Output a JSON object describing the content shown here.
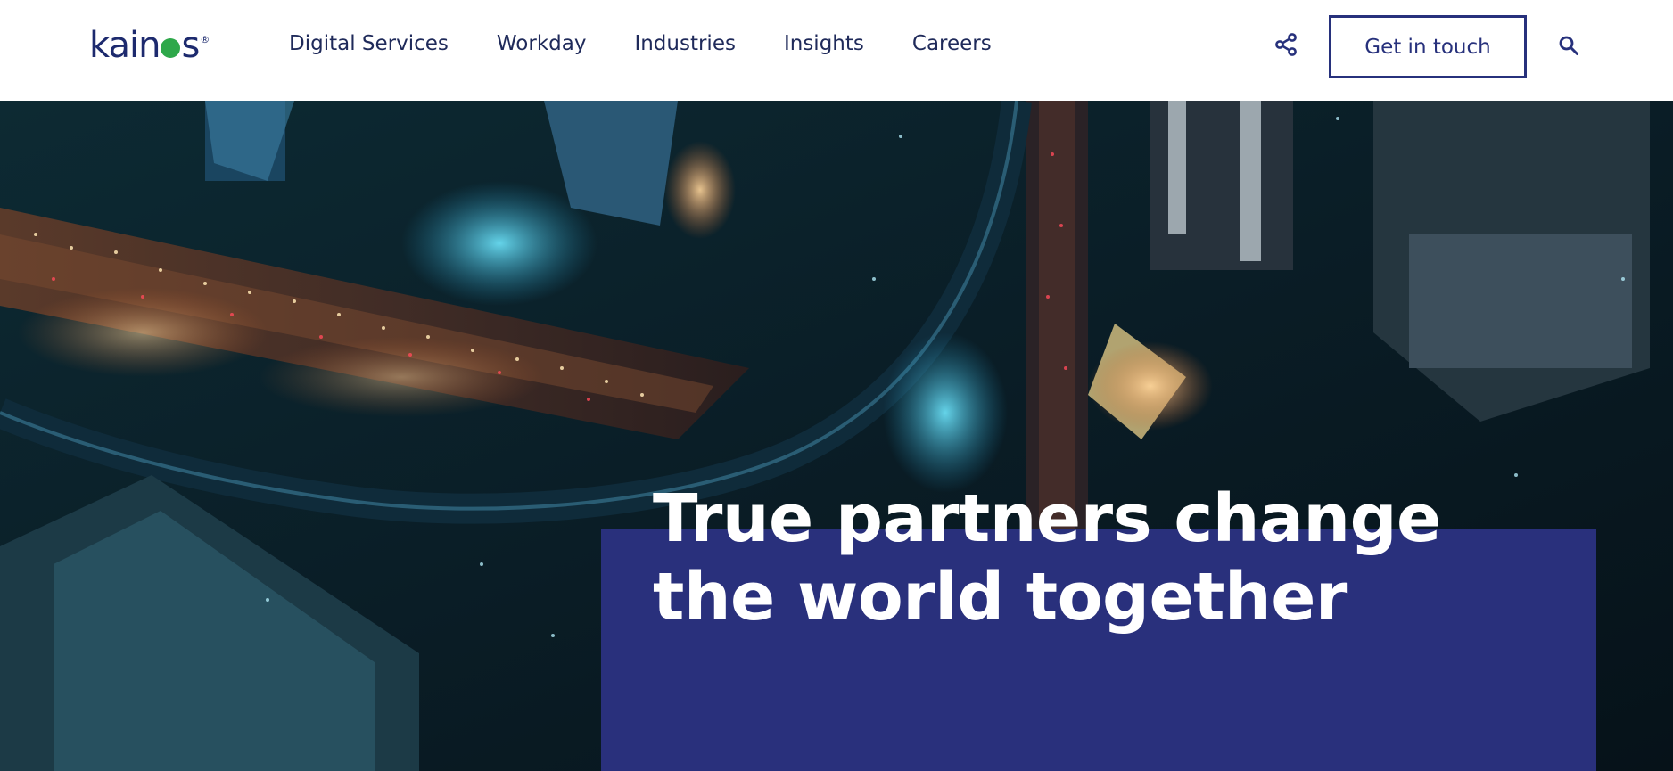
{
  "header": {
    "logo_text_left": "kai",
    "logo_text_right": "s",
    "logo_reg": "®",
    "nav": [
      {
        "label": "Digital Services"
      },
      {
        "label": "Workday"
      },
      {
        "label": "Industries"
      },
      {
        "label": "Insights"
      },
      {
        "label": "Careers"
      }
    ],
    "share_icon": "share-icon",
    "cta_label": "Get in touch",
    "search_icon": "search-icon"
  },
  "hero": {
    "headline": "True partners change the world together"
  },
  "colors": {
    "brand_navy": "#29307c",
    "text_dark": "#1f2a5a",
    "logo_green": "#2ea84a",
    "header_bg": "#ffffff"
  }
}
